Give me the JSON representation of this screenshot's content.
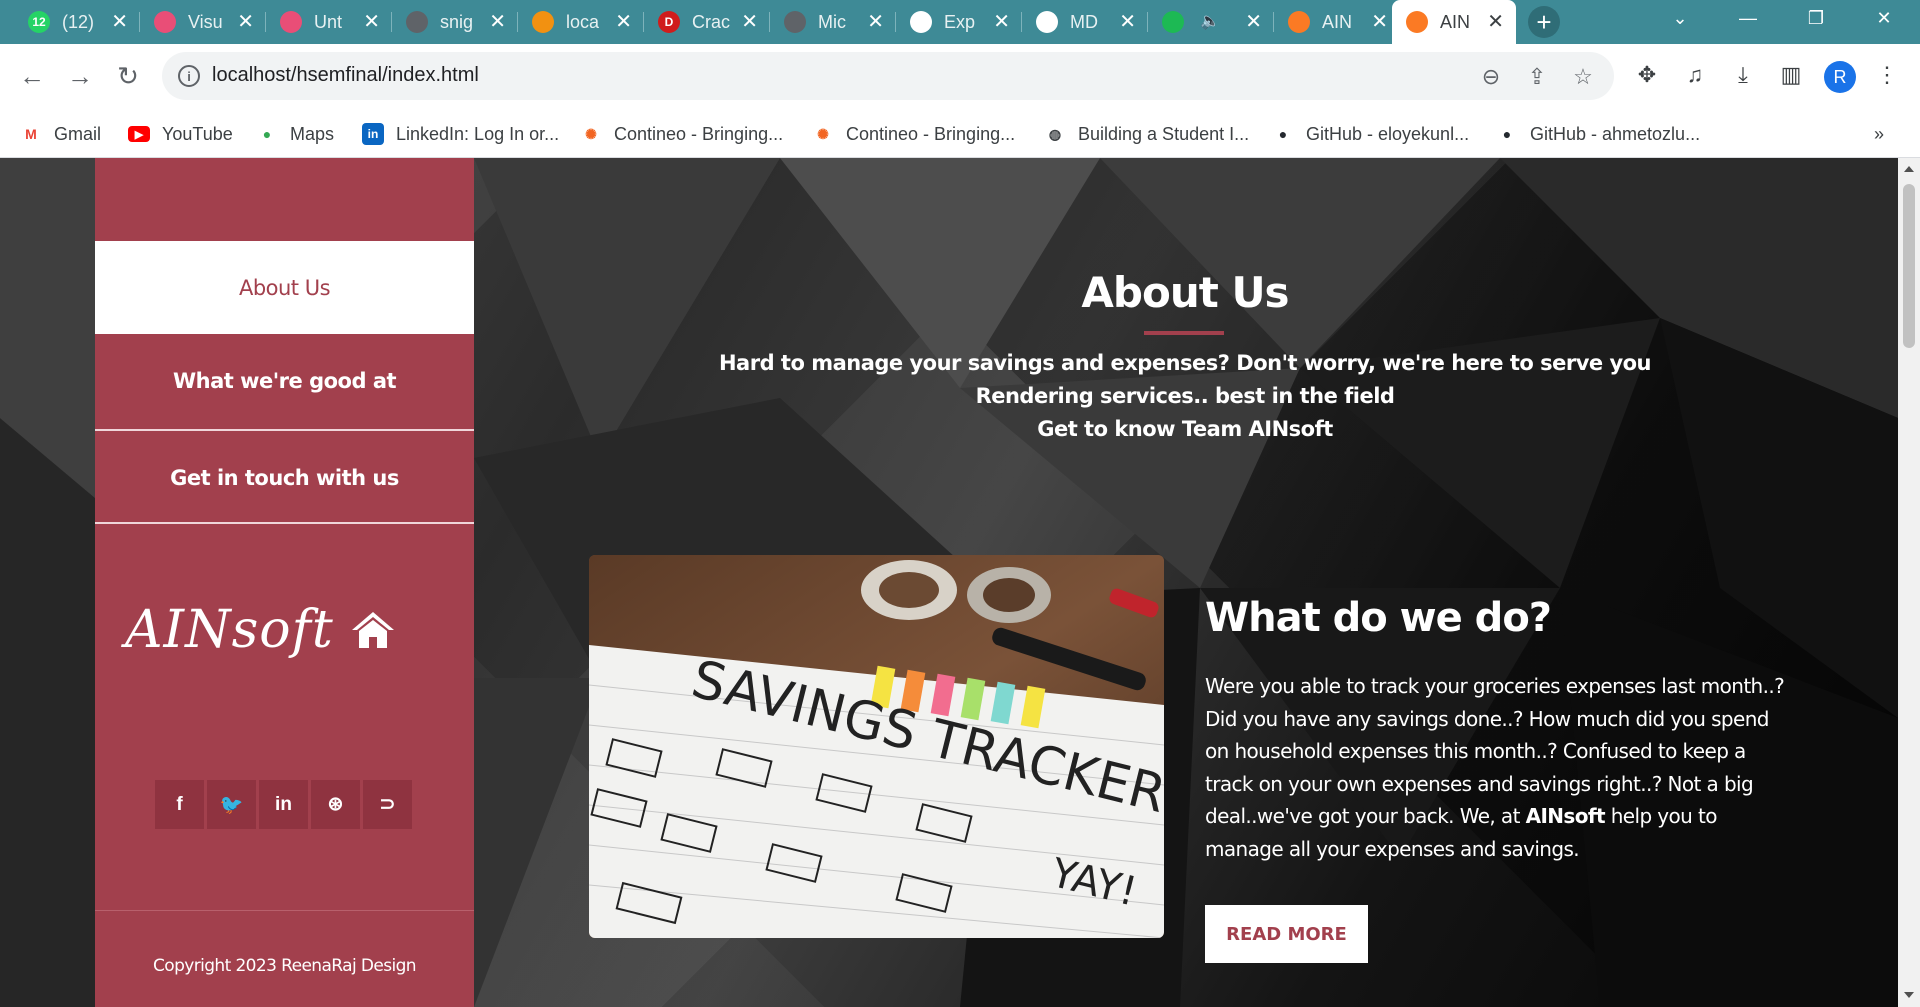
{
  "browser": {
    "tabs": [
      {
        "title": "(12)",
        "icon": "whatsapp-icon",
        "color": "#25d366",
        "badge": "12"
      },
      {
        "title": "Visu",
        "icon": "figma-icon",
        "color": "#e94e77",
        "badge": ""
      },
      {
        "title": "Unt",
        "icon": "figma-icon",
        "color": "#e94e77",
        "badge": ""
      },
      {
        "title": "snig",
        "icon": "globe-icon",
        "color": "#5f6368",
        "badge": ""
      },
      {
        "title": "loca",
        "icon": "phpmyadmin-icon",
        "color": "#f29111",
        "badge": ""
      },
      {
        "title": "Crac",
        "icon": "d-letter-icon",
        "color": "#d01c1c",
        "badge": "D"
      },
      {
        "title": "Mic",
        "icon": "globe-icon",
        "color": "#5f6368",
        "badge": ""
      },
      {
        "title": "Exp",
        "icon": "openai-icon",
        "color": "#ffffff",
        "badge": ""
      },
      {
        "title": "MD",
        "icon": "lock-icon",
        "color": "#ffffff",
        "badge": ""
      },
      {
        "title": "",
        "icon": "spotify-icon",
        "color": "#1db954",
        "badge": ""
      },
      {
        "title": "AIN",
        "icon": "xampp-icon",
        "color": "#fb7a24",
        "badge": ""
      },
      {
        "title": "AIN",
        "icon": "xampp-icon",
        "color": "#fb7a24",
        "badge": ""
      }
    ],
    "url": "localhost/hsemfinal/index.html",
    "profile_initial": "R",
    "bookmarks": [
      {
        "label": "Gmail",
        "icon": "gmail-icon",
        "color": "#ea4335"
      },
      {
        "label": "YouTube",
        "icon": "youtube-icon",
        "color": "#ff0000"
      },
      {
        "label": "Maps",
        "icon": "maps-icon",
        "color": "#34a853"
      },
      {
        "label": "LinkedIn: Log In or...",
        "icon": "linkedin-icon",
        "color": "#0a66c2"
      },
      {
        "label": "Contineo - Bringing...",
        "icon": "contineo-icon",
        "color": "#f26522"
      },
      {
        "label": "Contineo - Bringing...",
        "icon": "contineo-icon",
        "color": "#f26522"
      },
      {
        "label": "Building a Student I...",
        "icon": "globe-icon",
        "color": "#3c4043"
      },
      {
        "label": "GitHub - eloyekunl...",
        "icon": "github-icon",
        "color": "#24292f"
      },
      {
        "label": "GitHub - ahmetozlu...",
        "icon": "github-icon",
        "color": "#24292f"
      }
    ],
    "more_bookmarks": "»"
  },
  "sidebar": {
    "items": [
      {
        "label": "About Us",
        "active": true
      },
      {
        "label": "What we're good at",
        "active": false
      },
      {
        "label": "Get in touch with us",
        "active": false
      }
    ],
    "logo_text": "AINsoft",
    "socials": [
      {
        "icon": "facebook-icon",
        "glyph": "f"
      },
      {
        "icon": "twitter-icon",
        "glyph": "🐦"
      },
      {
        "icon": "linkedin-icon",
        "glyph": "in"
      },
      {
        "icon": "dribbble-icon",
        "glyph": "⊛"
      },
      {
        "icon": "rss-icon",
        "glyph": "⊃"
      }
    ],
    "copyright": "Copyright 2023 ReenaRaj Design"
  },
  "main": {
    "title": "About Us",
    "intro_lines": [
      "Hard to manage your savings and expenses? Don't worry, we're here to serve you",
      "Rendering services.. best in the field",
      "Get to know Team AINsoft"
    ],
    "image_text": "SAVINGS TRACKER",
    "image_text_2": "YAY!",
    "section_title": "What do we do?",
    "body_before": "Were you able to track your groceries expenses last month..? Did you have any savings done..? How much did you spend on household expenses this month..? Confused to keep a track on your own expenses and savings right..? Not a big deal..we've got your back. We, at ",
    "body_brand": "AINsoft",
    "body_after": " help you to manage all your expenses and savings.",
    "read_more": "READ MORE"
  },
  "colors": {
    "accent": "#a2404d",
    "tab_strip": "#3e8a96"
  }
}
